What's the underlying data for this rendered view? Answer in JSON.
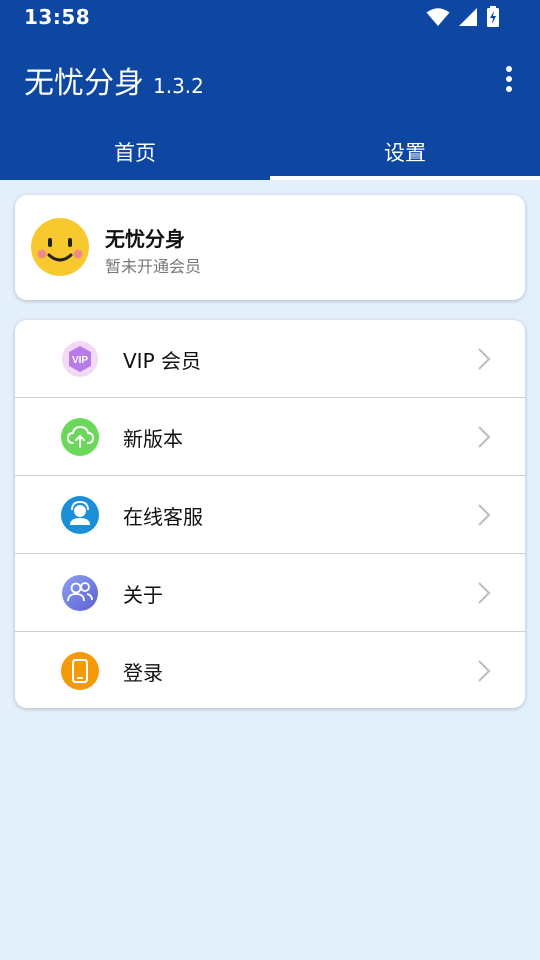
{
  "status_bar": {
    "time": "13:58"
  },
  "app_bar": {
    "title": "无忧分身",
    "version": "1.3.2",
    "tabs": [
      {
        "label": "首页",
        "active": false
      },
      {
        "label": "设置",
        "active": true
      }
    ]
  },
  "profile": {
    "name": "无忧分身",
    "membership_status": "暂未开通会员"
  },
  "menu": {
    "items": [
      {
        "label": "VIP 会员",
        "icon": "vip-icon",
        "color": "#b77ce8"
      },
      {
        "label": "新版本",
        "icon": "cloud-upload-icon",
        "color": "#6bd85c"
      },
      {
        "label": "在线客服",
        "icon": "customer-service-icon",
        "color": "#1a8fd8"
      },
      {
        "label": "关于",
        "icon": "users-icon",
        "color": "#6f7ddf"
      },
      {
        "label": "登录",
        "icon": "phone-icon",
        "color": "#f59a06"
      }
    ]
  },
  "colors": {
    "primary": "#0d47a1",
    "background": "#e3effb"
  }
}
